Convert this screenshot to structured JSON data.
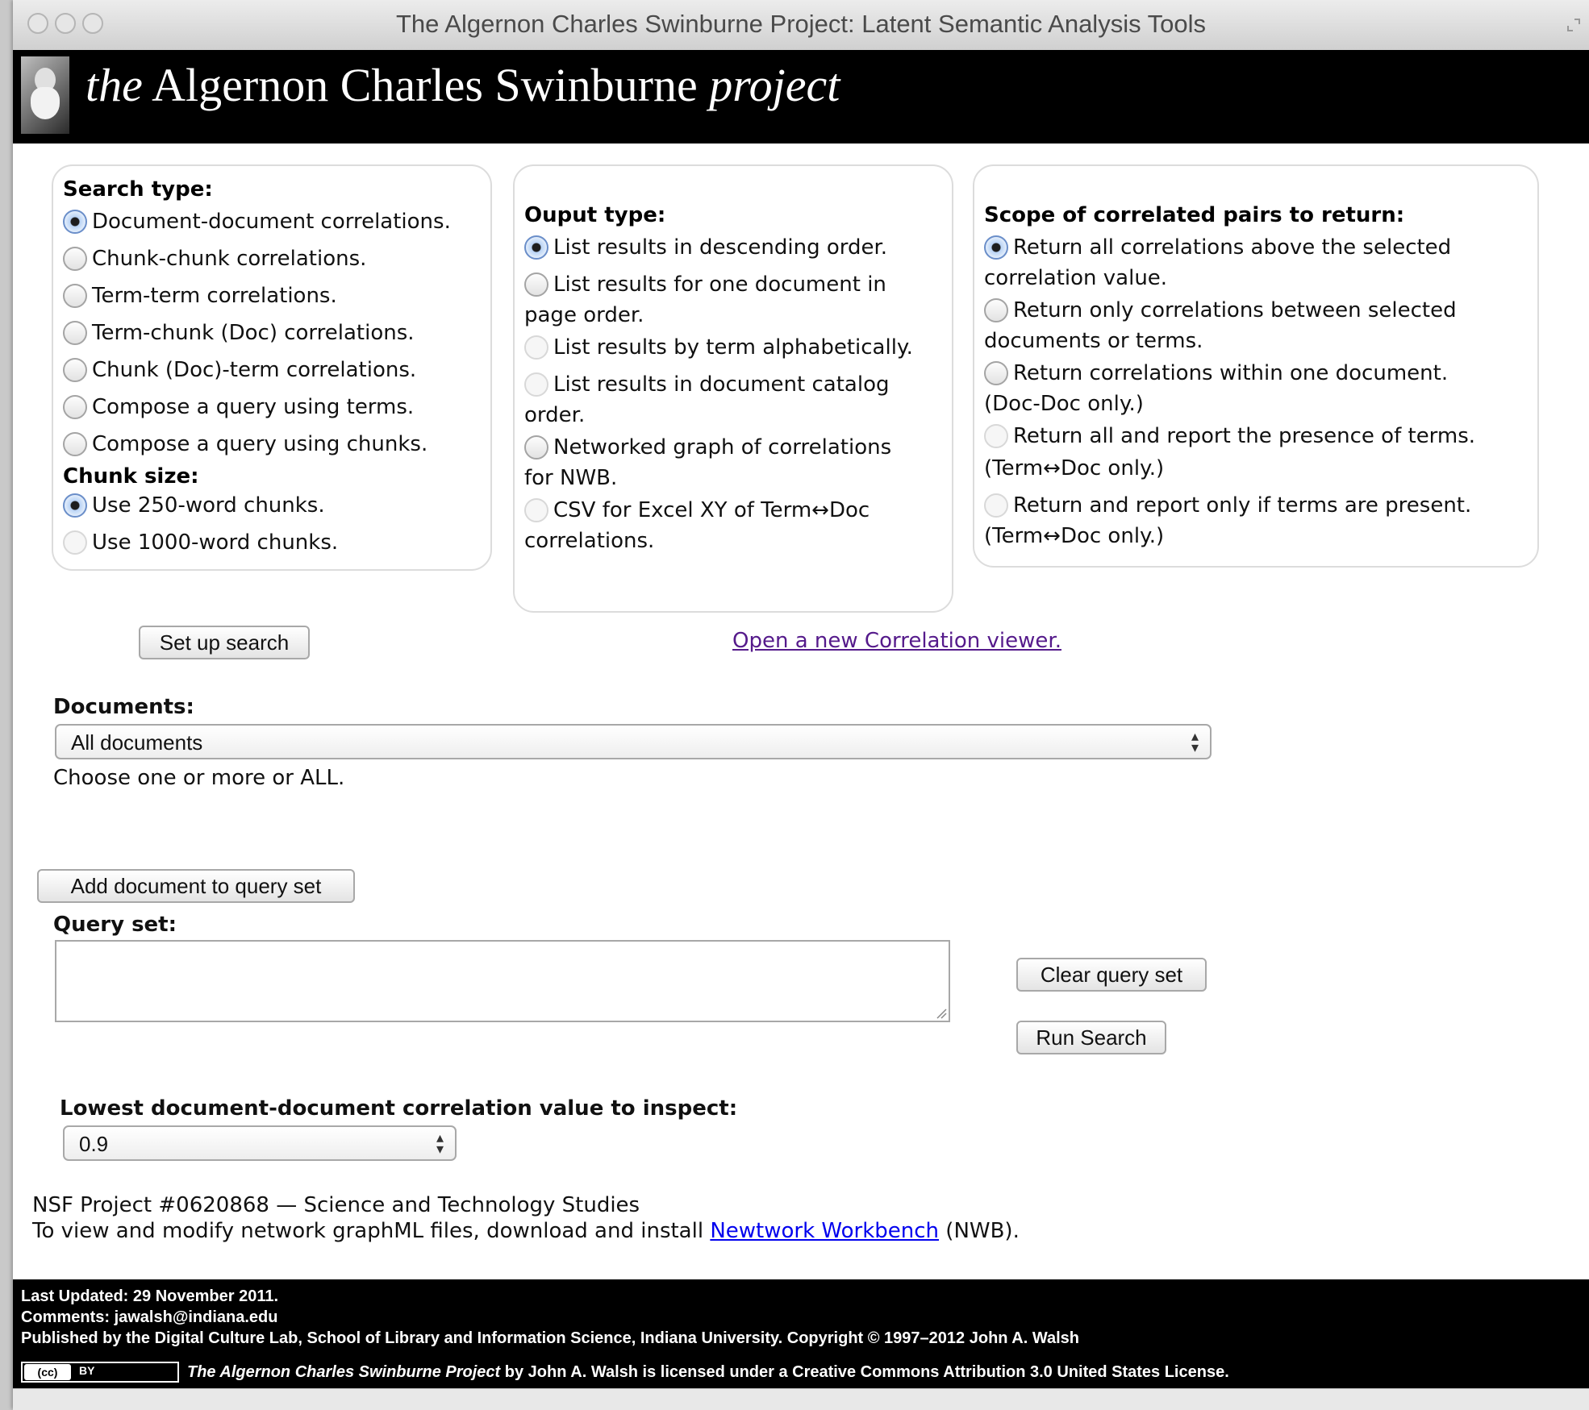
{
  "window": {
    "title": "The Algernon Charles Swinburne Project: Latent Semantic Analysis Tools"
  },
  "site": {
    "title_the": "the",
    "title_name": "Algernon Charles Swinburne",
    "title_project": "project"
  },
  "search_type": {
    "title": "Search type:",
    "options": [
      {
        "label": "Document-document correlations.",
        "checked": true
      },
      {
        "label": "Chunk-chunk correlations.",
        "checked": false
      },
      {
        "label": "Term-term correlations.",
        "checked": false
      },
      {
        "label": "Term-chunk (Doc) correlations.",
        "checked": false
      },
      {
        "label": "Chunk (Doc)-term correlations.",
        "checked": false
      },
      {
        "label": "Compose a query using terms.",
        "checked": false
      },
      {
        "label": "Compose a query using chunks.",
        "checked": false
      }
    ],
    "chunk_title": "Chunk size:",
    "chunk_options": [
      {
        "label": "Use 250-word chunks.",
        "checked": true
      },
      {
        "label": "Use 1000-word chunks.",
        "checked": false
      }
    ]
  },
  "output_type": {
    "title": "Ouput type:",
    "lines": [
      "List results in descending order.",
      "List results for one document in",
      "page order.",
      "List results by term alphabetically.",
      "List results in document catalog",
      "order.",
      "Networked graph of correlations",
      "for NWB.",
      "CSV for Excel XY of Term↔Doc",
      "correlations."
    ]
  },
  "scope": {
    "title": "Scope of correlated pairs to return:",
    "lines": [
      "Return all correlations above the selected",
      "correlation value.",
      "Return only correlations between selected",
      "documents or terms.",
      "Return correlations within one document.",
      "(Doc-Doc only.)",
      "Return all and report the presence of terms.",
      "(Term↔Doc only.)",
      "Return and report only if terms are present.",
      "(Term↔Doc only.)"
    ]
  },
  "buttons": {
    "setup": "Set up search",
    "add_doc": "Add document to query set",
    "clear": "Clear query set",
    "run": "Run Search"
  },
  "links": {
    "correlation_viewer": "Open a new Correlation viewer."
  },
  "documents": {
    "label": "Documents:",
    "selected": "All documents",
    "hint": "Choose one or more or ALL."
  },
  "query_set": {
    "label": "Query set:",
    "value": ""
  },
  "lowest": {
    "label": "Lowest document-document correlation value to inspect:",
    "selected": "0.9"
  },
  "info": {
    "nsf": "NSF Project #0620868 — Science and Technology Studies",
    "nwb_prefix": "To view and modify network graphML files, download and install",
    "nwb_link": "Newtwork Workbench",
    "nwb_suffix": "(NWB)."
  },
  "footer": {
    "updated": "Last Updated: 29 November 2011.",
    "comments": "Comments: jawalsh@indiana.edu",
    "published": "Published by the Digital Culture Lab, School of Library and Information Science, Indiana University. Copyright © 1997–2012 John A. Walsh",
    "cc_logo": "(cc)",
    "cc_by": "BY",
    "license_title": "The Algernon Charles Swinburne Project",
    "license_text": "by John A. Walsh is licensed under a Creative Commons Attribution 3.0 United States License."
  }
}
